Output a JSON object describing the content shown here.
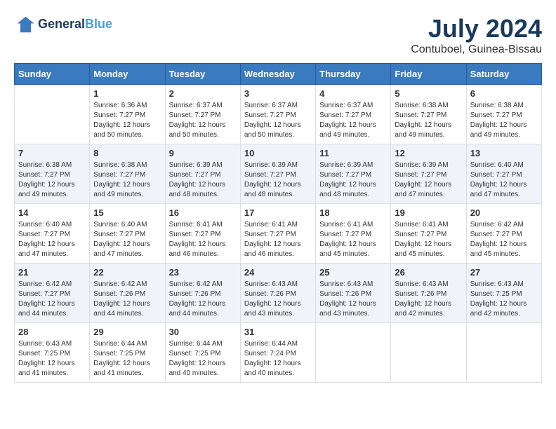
{
  "header": {
    "logo_line1": "General",
    "logo_line2": "Blue",
    "month": "July 2024",
    "location": "Contuboel, Guinea-Bissau"
  },
  "weekdays": [
    "Sunday",
    "Monday",
    "Tuesday",
    "Wednesday",
    "Thursday",
    "Friday",
    "Saturday"
  ],
  "weeks": [
    [
      {
        "day": "",
        "sunrise": "",
        "sunset": "",
        "daylight": ""
      },
      {
        "day": "1",
        "sunrise": "Sunrise: 6:36 AM",
        "sunset": "Sunset: 7:27 PM",
        "daylight": "Daylight: 12 hours and 50 minutes."
      },
      {
        "day": "2",
        "sunrise": "Sunrise: 6:37 AM",
        "sunset": "Sunset: 7:27 PM",
        "daylight": "Daylight: 12 hours and 50 minutes."
      },
      {
        "day": "3",
        "sunrise": "Sunrise: 6:37 AM",
        "sunset": "Sunset: 7:27 PM",
        "daylight": "Daylight: 12 hours and 50 minutes."
      },
      {
        "day": "4",
        "sunrise": "Sunrise: 6:37 AM",
        "sunset": "Sunset: 7:27 PM",
        "daylight": "Daylight: 12 hours and 49 minutes."
      },
      {
        "day": "5",
        "sunrise": "Sunrise: 6:38 AM",
        "sunset": "Sunset: 7:27 PM",
        "daylight": "Daylight: 12 hours and 49 minutes."
      },
      {
        "day": "6",
        "sunrise": "Sunrise: 6:38 AM",
        "sunset": "Sunset: 7:27 PM",
        "daylight": "Daylight: 12 hours and 49 minutes."
      }
    ],
    [
      {
        "day": "7",
        "sunrise": "Sunrise: 6:38 AM",
        "sunset": "Sunset: 7:27 PM",
        "daylight": "Daylight: 12 hours and 49 minutes."
      },
      {
        "day": "8",
        "sunrise": "Sunrise: 6:38 AM",
        "sunset": "Sunset: 7:27 PM",
        "daylight": "Daylight: 12 hours and 49 minutes."
      },
      {
        "day": "9",
        "sunrise": "Sunrise: 6:39 AM",
        "sunset": "Sunset: 7:27 PM",
        "daylight": "Daylight: 12 hours and 48 minutes."
      },
      {
        "day": "10",
        "sunrise": "Sunrise: 6:39 AM",
        "sunset": "Sunset: 7:27 PM",
        "daylight": "Daylight: 12 hours and 48 minutes."
      },
      {
        "day": "11",
        "sunrise": "Sunrise: 6:39 AM",
        "sunset": "Sunset: 7:27 PM",
        "daylight": "Daylight: 12 hours and 48 minutes."
      },
      {
        "day": "12",
        "sunrise": "Sunrise: 6:39 AM",
        "sunset": "Sunset: 7:27 PM",
        "daylight": "Daylight: 12 hours and 47 minutes."
      },
      {
        "day": "13",
        "sunrise": "Sunrise: 6:40 AM",
        "sunset": "Sunset: 7:27 PM",
        "daylight": "Daylight: 12 hours and 47 minutes."
      }
    ],
    [
      {
        "day": "14",
        "sunrise": "Sunrise: 6:40 AM",
        "sunset": "Sunset: 7:27 PM",
        "daylight": "Daylight: 12 hours and 47 minutes."
      },
      {
        "day": "15",
        "sunrise": "Sunrise: 6:40 AM",
        "sunset": "Sunset: 7:27 PM",
        "daylight": "Daylight: 12 hours and 47 minutes."
      },
      {
        "day": "16",
        "sunrise": "Sunrise: 6:41 AM",
        "sunset": "Sunset: 7:27 PM",
        "daylight": "Daylight: 12 hours and 46 minutes."
      },
      {
        "day": "17",
        "sunrise": "Sunrise: 6:41 AM",
        "sunset": "Sunset: 7:27 PM",
        "daylight": "Daylight: 12 hours and 46 minutes."
      },
      {
        "day": "18",
        "sunrise": "Sunrise: 6:41 AM",
        "sunset": "Sunset: 7:27 PM",
        "daylight": "Daylight: 12 hours and 45 minutes."
      },
      {
        "day": "19",
        "sunrise": "Sunrise: 6:41 AM",
        "sunset": "Sunset: 7:27 PM",
        "daylight": "Daylight: 12 hours and 45 minutes."
      },
      {
        "day": "20",
        "sunrise": "Sunrise: 6:42 AM",
        "sunset": "Sunset: 7:27 PM",
        "daylight": "Daylight: 12 hours and 45 minutes."
      }
    ],
    [
      {
        "day": "21",
        "sunrise": "Sunrise: 6:42 AM",
        "sunset": "Sunset: 7:27 PM",
        "daylight": "Daylight: 12 hours and 44 minutes."
      },
      {
        "day": "22",
        "sunrise": "Sunrise: 6:42 AM",
        "sunset": "Sunset: 7:26 PM",
        "daylight": "Daylight: 12 hours and 44 minutes."
      },
      {
        "day": "23",
        "sunrise": "Sunrise: 6:42 AM",
        "sunset": "Sunset: 7:26 PM",
        "daylight": "Daylight: 12 hours and 44 minutes."
      },
      {
        "day": "24",
        "sunrise": "Sunrise: 6:43 AM",
        "sunset": "Sunset: 7:26 PM",
        "daylight": "Daylight: 12 hours and 43 minutes."
      },
      {
        "day": "25",
        "sunrise": "Sunrise: 6:43 AM",
        "sunset": "Sunset: 7:26 PM",
        "daylight": "Daylight: 12 hours and 43 minutes."
      },
      {
        "day": "26",
        "sunrise": "Sunrise: 6:43 AM",
        "sunset": "Sunset: 7:26 PM",
        "daylight": "Daylight: 12 hours and 42 minutes."
      },
      {
        "day": "27",
        "sunrise": "Sunrise: 6:43 AM",
        "sunset": "Sunset: 7:25 PM",
        "daylight": "Daylight: 12 hours and 42 minutes."
      }
    ],
    [
      {
        "day": "28",
        "sunrise": "Sunrise: 6:43 AM",
        "sunset": "Sunset: 7:25 PM",
        "daylight": "Daylight: 12 hours and 41 minutes."
      },
      {
        "day": "29",
        "sunrise": "Sunrise: 6:44 AM",
        "sunset": "Sunset: 7:25 PM",
        "daylight": "Daylight: 12 hours and 41 minutes."
      },
      {
        "day": "30",
        "sunrise": "Sunrise: 6:44 AM",
        "sunset": "Sunset: 7:25 PM",
        "daylight": "Daylight: 12 hours and 40 minutes."
      },
      {
        "day": "31",
        "sunrise": "Sunrise: 6:44 AM",
        "sunset": "Sunset: 7:24 PM",
        "daylight": "Daylight: 12 hours and 40 minutes."
      },
      {
        "day": "",
        "sunrise": "",
        "sunset": "",
        "daylight": ""
      },
      {
        "day": "",
        "sunrise": "",
        "sunset": "",
        "daylight": ""
      },
      {
        "day": "",
        "sunrise": "",
        "sunset": "",
        "daylight": ""
      }
    ]
  ]
}
